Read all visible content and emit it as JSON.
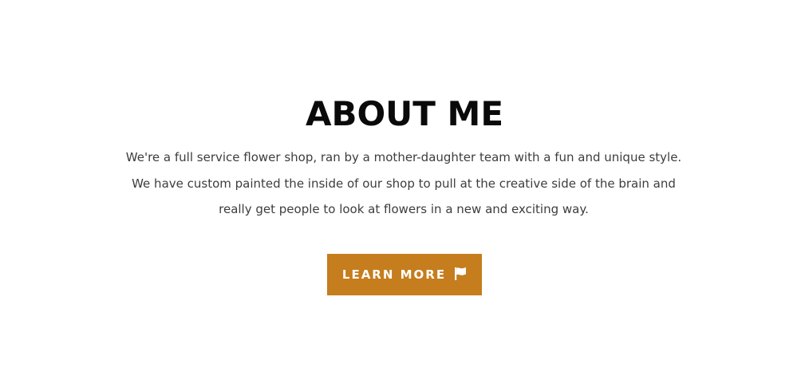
{
  "about": {
    "title": "ABOUT ME",
    "body_lines": [
      "We're a full service flower shop, ran by a mother-daughter team with a fun and unique style.",
      "We have custom painted the inside of our shop to pull at the creative side of the brain and",
      "really get people to look at flowers in a new and exciting way."
    ],
    "button": {
      "label": "LEARN MORE",
      "icon": "flag-icon"
    }
  },
  "colors": {
    "background": "#ffffff",
    "title": "#0a0a0a",
    "body_text": "#3d3d3d",
    "accent": "#c57d1d",
    "button_text": "#ffffff"
  }
}
